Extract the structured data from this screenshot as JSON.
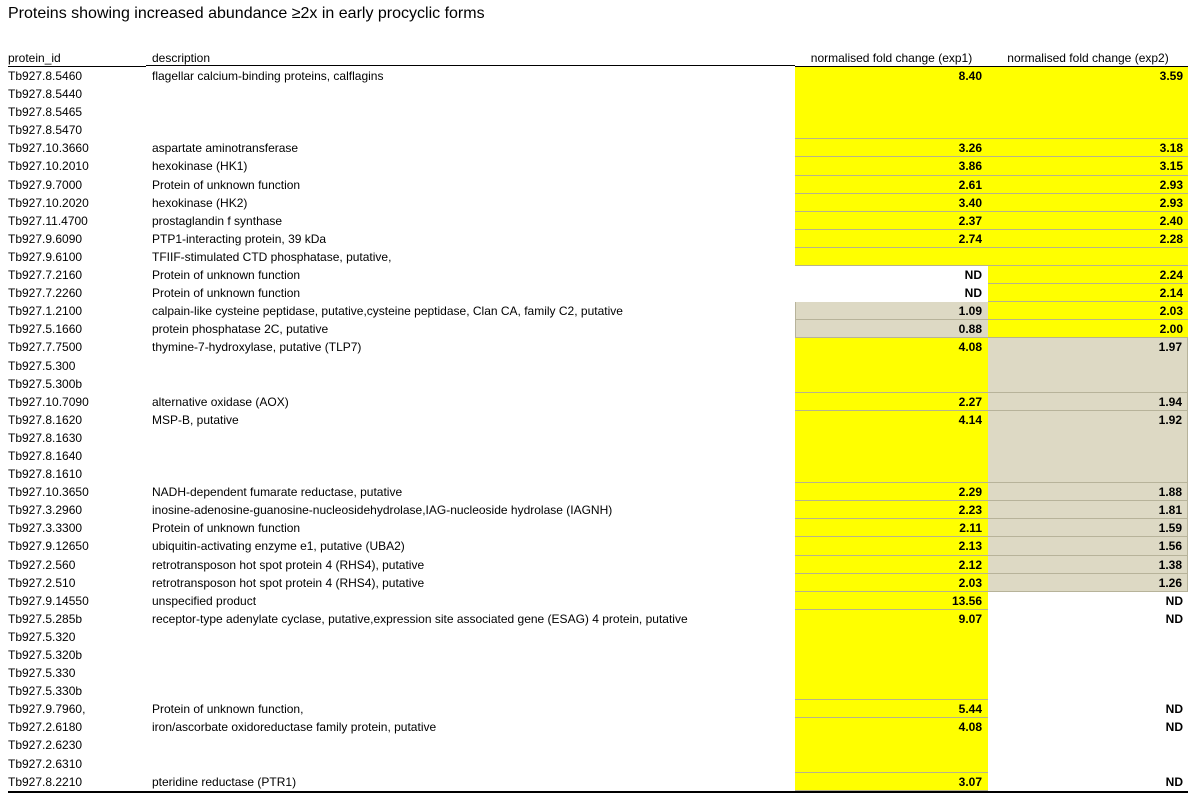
{
  "title": "Proteins showing increased abundance  ≥2x in early procyclic forms",
  "headers": {
    "protein_id": "protein_id",
    "description": "description",
    "exp1": "normalised fold change (exp1)",
    "exp2": "normalised fold change (exp2)"
  },
  "colors": {
    "highlight": "#ffff00",
    "neutral": "#ddd9c4"
  },
  "rows": [
    {
      "id": "Tb927.8.5460",
      "desc": "flagellar calcium-binding proteins, calflagins",
      "e1": "8.40",
      "e2": "3.59",
      "f1": "y",
      "f2": "y"
    },
    {
      "id": "Tb927.8.5440",
      "desc": "",
      "e1": "",
      "e2": "",
      "f1": "y",
      "f2": "y"
    },
    {
      "id": "Tb927.8.5465",
      "desc": "",
      "e1": "",
      "e2": "",
      "f1": "y",
      "f2": "y"
    },
    {
      "id": "Tb927.8.5470",
      "desc": "",
      "e1": "",
      "e2": "",
      "f1": "y",
      "f2": "y"
    },
    {
      "id": "Tb927.10.3660",
      "desc": "aspartate aminotransferase",
      "e1": "3.26",
      "e2": "3.18",
      "f1": "y",
      "f2": "y"
    },
    {
      "id": "Tb927.10.2010",
      "desc": "hexokinase (HK1)",
      "e1": "3.86",
      "e2": "3.15",
      "f1": "y",
      "f2": "y"
    },
    {
      "id": "Tb927.9.7000",
      "desc": "Protein of unknown function",
      "e1": "2.61",
      "e2": "2.93",
      "f1": "y",
      "f2": "y"
    },
    {
      "id": "Tb927.10.2020",
      "desc": "hexokinase (HK2)",
      "e1": "3.40",
      "e2": "2.93",
      "f1": "y",
      "f2": "y"
    },
    {
      "id": "Tb927.11.4700",
      "desc": "prostaglandin f synthase",
      "e1": "2.37",
      "e2": "2.40",
      "f1": "y",
      "f2": "y"
    },
    {
      "id": "Tb927.9.6090",
      "desc": "PTP1-interacting protein, 39 kDa",
      "e1": "2.74",
      "e2": "2.28",
      "f1": "y",
      "f2": "y"
    },
    {
      "id": "Tb927.9.6100",
      "desc": "TFIIF-stimulated CTD phosphatase, putative,",
      "e1": "",
      "e2": "",
      "f1": "y",
      "f2": "y"
    },
    {
      "id": "Tb927.7.2160",
      "desc": "Protein of unknown function",
      "e1": "ND",
      "e2": "2.24",
      "f1": "w",
      "f2": "y"
    },
    {
      "id": "Tb927.7.2260",
      "desc": "Protein of unknown function",
      "e1": "ND",
      "e2": "2.14",
      "f1": "w",
      "f2": "y"
    },
    {
      "id": "Tb927.1.2100",
      "desc": "calpain-like cysteine peptidase, putative,cysteine peptidase, Clan CA, family C2, putative",
      "e1": "1.09",
      "e2": "2.03",
      "f1": "g",
      "f2": "y"
    },
    {
      "id": "Tb927.5.1660",
      "desc": "protein phosphatase 2C, putative",
      "e1": "0.88",
      "e2": "2.00",
      "f1": "g",
      "f2": "y"
    },
    {
      "id": "Tb927.7.7500",
      "desc": "thymine-7-hydroxylase, putative (TLP7)",
      "e1": "4.08",
      "e2": "1.97",
      "f1": "y",
      "f2": "g"
    },
    {
      "id": "Tb927.5.300",
      "desc": "",
      "e1": "",
      "e2": "",
      "f1": "y",
      "f2": "g"
    },
    {
      "id": "Tb927.5.300b",
      "desc": "",
      "e1": "",
      "e2": "",
      "f1": "y",
      "f2": "g"
    },
    {
      "id": "Tb927.10.7090",
      "desc": "alternative oxidase (AOX)",
      "e1": "2.27",
      "e2": "1.94",
      "f1": "y",
      "f2": "g"
    },
    {
      "id": "Tb927.8.1620",
      "desc": "MSP-B, putative",
      "e1": "4.14",
      "e2": "1.92",
      "f1": "y",
      "f2": "g"
    },
    {
      "id": "Tb927.8.1630",
      "desc": "",
      "e1": "",
      "e2": "",
      "f1": "y",
      "f2": "g"
    },
    {
      "id": "Tb927.8.1640",
      "desc": "",
      "e1": "",
      "e2": "",
      "f1": "y",
      "f2": "g"
    },
    {
      "id": "Tb927.8.1610",
      "desc": "",
      "e1": "",
      "e2": "",
      "f1": "y",
      "f2": "g"
    },
    {
      "id": "Tb927.10.3650",
      "desc": "NADH-dependent fumarate reductase, putative",
      "e1": "2.29",
      "e2": "1.88",
      "f1": "y",
      "f2": "g"
    },
    {
      "id": "Tb927.3.2960",
      "desc": "inosine-adenosine-guanosine-nucleosidehydrolase,IAG-nucleoside hydrolase (IAGNH)",
      "e1": "2.23",
      "e2": "1.81",
      "f1": "y",
      "f2": "g"
    },
    {
      "id": "Tb927.3.3300",
      "desc": "Protein of unknown function",
      "e1": "2.11",
      "e2": "1.59",
      "f1": "y",
      "f2": "g"
    },
    {
      "id": "Tb927.9.12650",
      "desc": "ubiquitin-activating enzyme e1, putative (UBA2)",
      "e1": "2.13",
      "e2": "1.56",
      "f1": "y",
      "f2": "g"
    },
    {
      "id": "Tb927.2.560",
      "desc": "retrotransposon hot spot protein 4 (RHS4), putative",
      "e1": "2.12",
      "e2": "1.38",
      "f1": "y",
      "f2": "g"
    },
    {
      "id": "Tb927.2.510",
      "desc": "retrotransposon hot spot protein 4 (RHS4), putative",
      "e1": "2.03",
      "e2": "1.26",
      "f1": "y",
      "f2": "g"
    },
    {
      "id": "Tb927.9.14550",
      "desc": "unspecified product",
      "e1": "13.56",
      "e2": "ND",
      "f1": "y",
      "f2": "w"
    },
    {
      "id": "Tb927.5.285b",
      "desc": "receptor-type adenylate cyclase, putative,expression site associated gene (ESAG) 4 protein, putative",
      "e1": "9.07",
      "e2": "ND",
      "f1": "y",
      "f2": "w"
    },
    {
      "id": "Tb927.5.320",
      "desc": "",
      "e1": "",
      "e2": "",
      "f1": "y",
      "f2": "w"
    },
    {
      "id": "Tb927.5.320b",
      "desc": "",
      "e1": "",
      "e2": "",
      "f1": "y",
      "f2": "w"
    },
    {
      "id": "Tb927.5.330",
      "desc": "",
      "e1": "",
      "e2": "",
      "f1": "y",
      "f2": "w"
    },
    {
      "id": "Tb927.5.330b",
      "desc": "",
      "e1": "",
      "e2": "",
      "f1": "y",
      "f2": "w"
    },
    {
      "id": "Tb927.9.7960,",
      "desc": "Protein of unknown function,",
      "e1": "5.44",
      "e2": "ND",
      "f1": "y",
      "f2": "w"
    },
    {
      "id": "Tb927.2.6180",
      "desc": "iron/ascorbate oxidoreductase family protein, putative",
      "e1": "4.08",
      "e2": "ND",
      "f1": "y",
      "f2": "w"
    },
    {
      "id": "Tb927.2.6230",
      "desc": "",
      "e1": "",
      "e2": "",
      "f1": "y",
      "f2": "w"
    },
    {
      "id": "Tb927.2.6310",
      "desc": "",
      "e1": "",
      "e2": "",
      "f1": "y",
      "f2": "w"
    },
    {
      "id": "Tb927.8.2210",
      "desc": "pteridine reductase (PTR1)",
      "e1": "3.07",
      "e2": "ND",
      "f1": "y",
      "f2": "w"
    }
  ]
}
